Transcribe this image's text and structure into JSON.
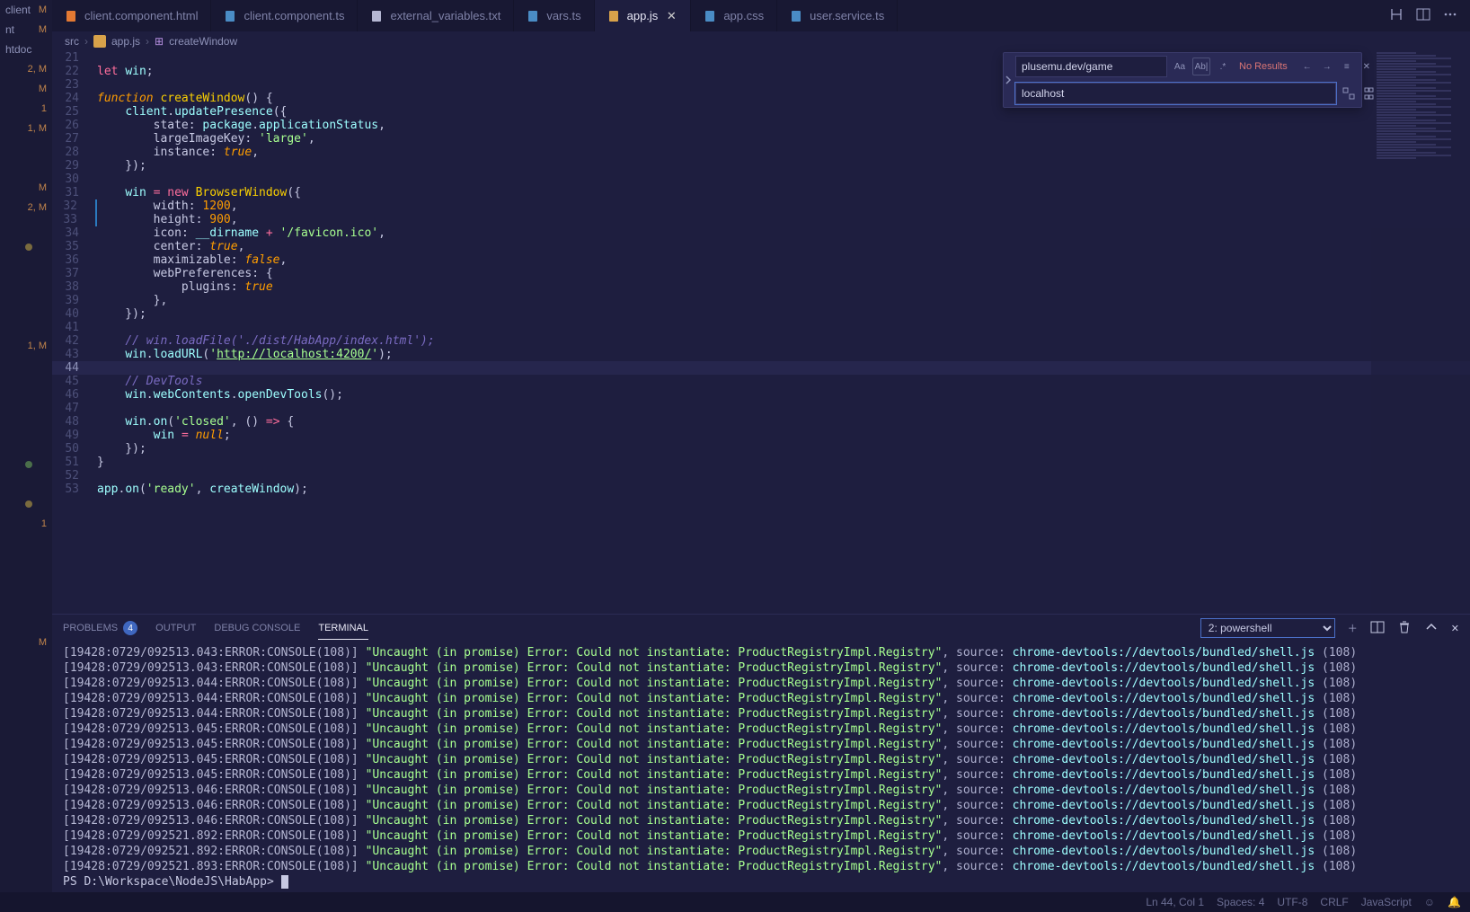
{
  "sidebar": {
    "entries": [
      {
        "lbl": "client",
        "st": "M"
      },
      {
        "lbl": "nt",
        "st": "M"
      },
      {
        "lbl": "htdocs/ga...",
        "st": ""
      },
      {
        "lbl": "",
        "st": "2, M"
      },
      {
        "lbl": "",
        "st": "M"
      },
      {
        "lbl": "",
        "st": "1"
      },
      {
        "lbl": "",
        "st": "1, M"
      },
      {
        "lbl": "",
        "st": ""
      },
      {
        "lbl": "",
        "st": ""
      },
      {
        "lbl": "",
        "st": "M"
      },
      {
        "lbl": "",
        "st": "2, M"
      },
      {
        "lbl": "",
        "st": ""
      },
      {
        "lbl": "",
        "st": "",
        "dot": true
      },
      {
        "lbl": "",
        "st": ""
      },
      {
        "lbl": "",
        "st": ""
      },
      {
        "lbl": "",
        "st": ""
      },
      {
        "lbl": "",
        "st": ""
      },
      {
        "lbl": "",
        "st": "1, M"
      },
      {
        "lbl": "",
        "st": ""
      },
      {
        "lbl": "",
        "st": ""
      },
      {
        "lbl": "",
        "st": ""
      },
      {
        "lbl": "",
        "st": ""
      },
      {
        "lbl": "",
        "st": ""
      },
      {
        "lbl": "",
        "st": "",
        "dot": true,
        "dotg": true
      },
      {
        "lbl": "",
        "st": ""
      },
      {
        "lbl": "",
        "st": "",
        "dot": true
      },
      {
        "lbl": "",
        "st": "1"
      },
      {
        "lbl": "",
        "st": ""
      },
      {
        "lbl": "",
        "st": ""
      },
      {
        "lbl": "",
        "st": ""
      },
      {
        "lbl": "",
        "st": ""
      },
      {
        "lbl": "",
        "st": ""
      },
      {
        "lbl": "",
        "st": "M"
      }
    ]
  },
  "tabs": [
    {
      "icon": "html",
      "label": "client.component.html",
      "active": false
    },
    {
      "icon": "ts",
      "label": "client.component.ts",
      "active": false
    },
    {
      "icon": "txt",
      "label": "external_variables.txt",
      "active": false
    },
    {
      "icon": "ts",
      "label": "vars.ts",
      "active": false
    },
    {
      "icon": "js",
      "label": "app.js",
      "active": true,
      "close": true
    },
    {
      "icon": "css",
      "label": "app.css",
      "active": false
    },
    {
      "icon": "ts",
      "label": "user.service.ts",
      "active": false
    }
  ],
  "breadcrumb": {
    "root": "src",
    "file": "app.js",
    "symbol": "createWindow"
  },
  "search": {
    "find": "plusemu.dev/game",
    "replace": "localhost",
    "result": "No Results"
  },
  "code_lines": [
    {
      "n": 21,
      "html": ""
    },
    {
      "n": 22,
      "html": "<span class='tok-kw'>let</span> <span class='tok-var'>win</span>;"
    },
    {
      "n": 23,
      "html": ""
    },
    {
      "n": 24,
      "html": "<span class='tok-kw2'>function</span> <span class='tok-fn'>createWindow</span>() {"
    },
    {
      "n": 25,
      "html": "    <span class='tok-var'>client</span>.<span class='tok-method'>updatePresence</span>({"
    },
    {
      "n": 26,
      "html": "        <span class='tok-prop'>state</span>: <span class='tok-var'>package</span>.<span class='tok-method'>applicationStatus</span>,"
    },
    {
      "n": 27,
      "html": "        <span class='tok-prop'>largeImageKey</span>: <span class='tok-str'>'large'</span>,"
    },
    {
      "n": 28,
      "html": "        <span class='tok-prop'>instance</span>: <span class='tok-bool'>true</span>,"
    },
    {
      "n": 29,
      "html": "    });"
    },
    {
      "n": 30,
      "html": ""
    },
    {
      "n": 31,
      "html": "    <span class='tok-var'>win</span> <span class='tok-kw'>=</span> <span class='tok-kw'>new</span> <span class='tok-obj'>BrowserWindow</span>({"
    },
    {
      "n": 32,
      "html": "        <span class='tok-prop'>width</span>: <span class='tok-num'>1200</span>,",
      "mod": true
    },
    {
      "n": 33,
      "html": "        <span class='tok-prop'>height</span>: <span class='tok-num'>900</span>,",
      "mod": true
    },
    {
      "n": 34,
      "html": "        <span class='tok-prop'>icon</span>: <span class='tok-var'>__dirname</span> <span class='tok-kw'>+</span> <span class='tok-str'>'/favicon.ico'</span>,"
    },
    {
      "n": 35,
      "html": "        <span class='tok-prop'>center</span>: <span class='tok-bool'>true</span>,"
    },
    {
      "n": 36,
      "html": "        <span class='tok-prop'>maximizable</span>: <span class='tok-bool'>false</span>,"
    },
    {
      "n": 37,
      "html": "        <span class='tok-prop'>webPreferences</span>: {"
    },
    {
      "n": 38,
      "html": "            <span class='tok-prop'>plugins</span>: <span class='tok-bool'>true</span>"
    },
    {
      "n": 39,
      "html": "        },"
    },
    {
      "n": 40,
      "html": "    });"
    },
    {
      "n": 41,
      "html": ""
    },
    {
      "n": 42,
      "html": "    <span class='tok-cm'>// win.loadFile('./dist/HabApp/index.html');</span>"
    },
    {
      "n": 43,
      "html": "    <span class='tok-var'>win</span>.<span class='tok-method'>loadURL</span>(<span class='tok-str'>'</span><span class='tok-strunl'>http://localhost:4200/</span><span class='tok-str'>'</span>);"
    },
    {
      "n": 44,
      "html": "",
      "current": true
    },
    {
      "n": 45,
      "html": "    <span class='tok-cm'>// DevTools</span>"
    },
    {
      "n": 46,
      "html": "    <span class='tok-var'>win</span>.<span class='tok-var'>webContents</span>.<span class='tok-method'>openDevTools</span>();"
    },
    {
      "n": 47,
      "html": ""
    },
    {
      "n": 48,
      "html": "    <span class='tok-var'>win</span>.<span class='tok-method'>on</span>(<span class='tok-str'>'closed'</span>, () <span class='tok-kw'>=></span> {"
    },
    {
      "n": 49,
      "html": "        <span class='tok-var'>win</span> <span class='tok-kw'>=</span> <span class='tok-bool'>null</span>;"
    },
    {
      "n": 50,
      "html": "    });"
    },
    {
      "n": 51,
      "html": "}"
    },
    {
      "n": 52,
      "html": ""
    },
    {
      "n": 53,
      "html": "<span class='tok-var'>app</span>.<span class='tok-method'>on</span>(<span class='tok-str'>'ready'</span>, <span class='tok-var'>createWindow</span>);"
    }
  ],
  "panel": {
    "tabs": {
      "problems": "PROBLEMS",
      "problems_count": "4",
      "output": "OUTPUT",
      "debug": "DEBUG CONSOLE",
      "terminal": "TERMINAL"
    },
    "select": "2: powershell",
    "term_lines": [
      "[19428:0729/092513.043:ERROR:CONSOLE(108)] \"Uncaught (in promise) Error: Could not instantiate: ProductRegistryImpl.Registry\", source: chrome-devtools://devtools/bundled/shell.js (108)",
      "[19428:0729/092513.043:ERROR:CONSOLE(108)] \"Uncaught (in promise) Error: Could not instantiate: ProductRegistryImpl.Registry\", source: chrome-devtools://devtools/bundled/shell.js (108)",
      "[19428:0729/092513.044:ERROR:CONSOLE(108)] \"Uncaught (in promise) Error: Could not instantiate: ProductRegistryImpl.Registry\", source: chrome-devtools://devtools/bundled/shell.js (108)",
      "[19428:0729/092513.044:ERROR:CONSOLE(108)] \"Uncaught (in promise) Error: Could not instantiate: ProductRegistryImpl.Registry\", source: chrome-devtools://devtools/bundled/shell.js (108)",
      "[19428:0729/092513.044:ERROR:CONSOLE(108)] \"Uncaught (in promise) Error: Could not instantiate: ProductRegistryImpl.Registry\", source: chrome-devtools://devtools/bundled/shell.js (108)",
      "[19428:0729/092513.045:ERROR:CONSOLE(108)] \"Uncaught (in promise) Error: Could not instantiate: ProductRegistryImpl.Registry\", source: chrome-devtools://devtools/bundled/shell.js (108)",
      "[19428:0729/092513.045:ERROR:CONSOLE(108)] \"Uncaught (in promise) Error: Could not instantiate: ProductRegistryImpl.Registry\", source: chrome-devtools://devtools/bundled/shell.js (108)",
      "[19428:0729/092513.045:ERROR:CONSOLE(108)] \"Uncaught (in promise) Error: Could not instantiate: ProductRegistryImpl.Registry\", source: chrome-devtools://devtools/bundled/shell.js (108)",
      "[19428:0729/092513.045:ERROR:CONSOLE(108)] \"Uncaught (in promise) Error: Could not instantiate: ProductRegistryImpl.Registry\", source: chrome-devtools://devtools/bundled/shell.js (108)",
      "[19428:0729/092513.046:ERROR:CONSOLE(108)] \"Uncaught (in promise) Error: Could not instantiate: ProductRegistryImpl.Registry\", source: chrome-devtools://devtools/bundled/shell.js (108)",
      "[19428:0729/092513.046:ERROR:CONSOLE(108)] \"Uncaught (in promise) Error: Could not instantiate: ProductRegistryImpl.Registry\", source: chrome-devtools://devtools/bundled/shell.js (108)",
      "[19428:0729/092513.046:ERROR:CONSOLE(108)] \"Uncaught (in promise) Error: Could not instantiate: ProductRegistryImpl.Registry\", source: chrome-devtools://devtools/bundled/shell.js (108)",
      "[19428:0729/092521.892:ERROR:CONSOLE(108)] \"Uncaught (in promise) Error: Could not instantiate: ProductRegistryImpl.Registry\", source: chrome-devtools://devtools/bundled/shell.js (108)",
      "[19428:0729/092521.892:ERROR:CONSOLE(108)] \"Uncaught (in promise) Error: Could not instantiate: ProductRegistryImpl.Registry\", source: chrome-devtools://devtools/bundled/shell.js (108)",
      "[19428:0729/092521.893:ERROR:CONSOLE(108)] \"Uncaught (in promise) Error: Could not instantiate: ProductRegistryImpl.Registry\", source: chrome-devtools://devtools/bundled/shell.js (108)"
    ],
    "prompt": "PS D:\\Workspace\\NodeJS\\HabApp> "
  },
  "status": {
    "ln": "Ln 44, Col 1",
    "spaces": "Spaces: 4",
    "enc": "UTF-8",
    "eol": "CRLF",
    "lang": "JavaScript"
  }
}
